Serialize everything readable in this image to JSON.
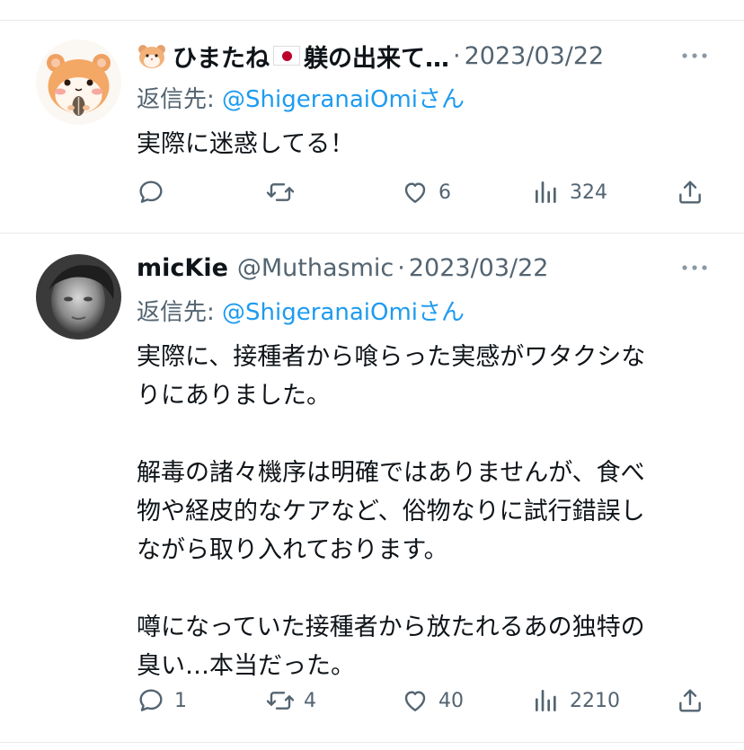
{
  "tweets": [
    {
      "display_name": "ひまたね",
      "display_name_suffix": "躾の出来て…",
      "handle": "",
      "date": "2023/03/22",
      "reply_label": "返信先:",
      "reply_mention": "@ShigeranaiOmi",
      "reply_suffix": "さん",
      "body": [
        "実際に迷惑してる！"
      ],
      "replies": "",
      "retweets": "",
      "likes": "6",
      "views": "324",
      "avatar": "hamster-avatar"
    },
    {
      "display_name": "micKie",
      "handle": "@Muthasmic",
      "date": "2023/03/22",
      "reply_label": "返信先:",
      "reply_mention": "@ShigeranaiOmi",
      "reply_suffix": "さん",
      "body": [
        "実際に、接種者から喰らった実感がワタクシな",
        "りにありました。",
        "解毒の諸々機序は明確ではありませんが、食べ",
        "物や経皮的なケアなど、俗物なりに試行錯誤し",
        "ながら取り入れております。",
        "噂になっていた接種者から放たれるあの独特の",
        "臭い…本当だった。"
      ],
      "replies": "1",
      "retweets": "4",
      "likes": "40",
      "views": "2210",
      "avatar": "photo-avatar"
    }
  ],
  "colors": {
    "text": "#0f1419",
    "secondary": "#536471",
    "link": "#1d9bf0",
    "divider": "#e6e9ec"
  }
}
